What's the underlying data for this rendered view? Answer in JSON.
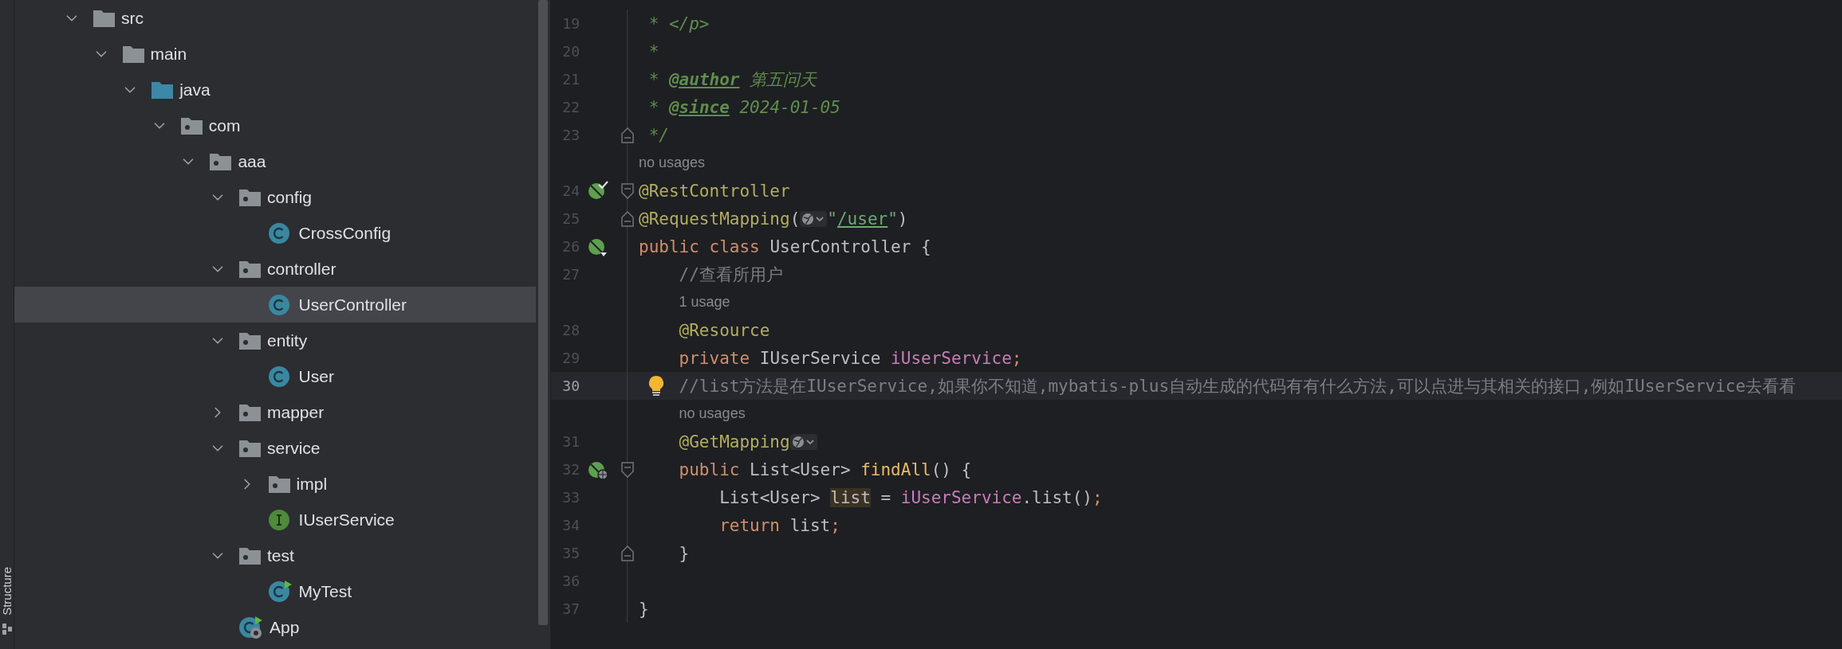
{
  "tool_strip": {
    "label": "Structure"
  },
  "project_tree": [
    {
      "label": "src",
      "kind": "folder",
      "expanded": true,
      "selected": false,
      "children": [
        {
          "label": "main",
          "kind": "folder",
          "expanded": true,
          "selected": false,
          "children": [
            {
              "label": "java",
              "kind": "source-folder",
              "expanded": true,
              "selected": false,
              "children": [
                {
                  "label": "com",
                  "kind": "package",
                  "expanded": true,
                  "selected": false,
                  "children": [
                    {
                      "label": "aaa",
                      "kind": "package",
                      "expanded": true,
                      "selected": false,
                      "children": [
                        {
                          "label": "config",
                          "kind": "package",
                          "expanded": true,
                          "selected": false,
                          "children": [
                            {
                              "label": "CrossConfig",
                              "kind": "class",
                              "selected": false
                            }
                          ]
                        },
                        {
                          "label": "controller",
                          "kind": "package",
                          "expanded": true,
                          "selected": false,
                          "children": [
                            {
                              "label": "UserController",
                              "kind": "class",
                              "selected": true
                            }
                          ]
                        },
                        {
                          "label": "entity",
                          "kind": "package",
                          "expanded": true,
                          "selected": false,
                          "children": [
                            {
                              "label": "User",
                              "kind": "class",
                              "selected": false
                            }
                          ]
                        },
                        {
                          "label": "mapper",
                          "kind": "package",
                          "expanded": false,
                          "selected": false
                        },
                        {
                          "label": "service",
                          "kind": "package",
                          "expanded": true,
                          "selected": false,
                          "children": [
                            {
                              "label": "impl",
                              "kind": "package",
                              "expanded": false,
                              "selected": false
                            },
                            {
                              "label": "IUserService",
                              "kind": "interface",
                              "selected": false
                            }
                          ]
                        },
                        {
                          "label": "test",
                          "kind": "package",
                          "expanded": true,
                          "selected": false,
                          "children": [
                            {
                              "label": "MyTest",
                              "kind": "test-class",
                              "selected": false
                            }
                          ]
                        },
                        {
                          "label": "App",
                          "kind": "app-class",
                          "selected": false
                        }
                      ]
                    }
                  ]
                }
              ]
            }
          ]
        }
      ]
    }
  ],
  "editor_lines": [
    {
      "kind": "code",
      "number": "19",
      "current": false,
      "tokens": [
        {
          "kind": "doc",
          "text": " * </p>"
        }
      ]
    },
    {
      "kind": "code",
      "number": "20",
      "current": false,
      "tokens": [
        {
          "kind": "doc",
          "text": " *"
        }
      ]
    },
    {
      "kind": "code",
      "number": "21",
      "current": false,
      "tokens": [
        {
          "kind": "doc",
          "text": " * "
        },
        {
          "kind": "doctag",
          "text": "@author"
        },
        {
          "kind": "doc",
          "text": " 第五问天"
        }
      ]
    },
    {
      "kind": "code",
      "number": "22",
      "current": false,
      "tokens": [
        {
          "kind": "doc",
          "text": " * "
        },
        {
          "kind": "doctag",
          "text": "@since"
        },
        {
          "kind": "doc",
          "text": " 2024-01-05"
        }
      ]
    },
    {
      "kind": "code",
      "number": "23",
      "current": false,
      "fold": {
        "kind": "end"
      },
      "tokens": [
        {
          "kind": "doc",
          "text": " */"
        }
      ]
    },
    {
      "kind": "inlay",
      "text": "no usages"
    },
    {
      "kind": "code",
      "number": "24",
      "current": false,
      "fold": {
        "kind": "start"
      },
      "gutter_icon": {
        "kind": "bean-check"
      },
      "tokens": [
        {
          "kind": "annotation",
          "text": "@RestController"
        }
      ]
    },
    {
      "kind": "code",
      "number": "25",
      "current": false,
      "fold": {
        "kind": "end"
      },
      "tokens": [
        {
          "kind": "annotation",
          "text": "@RequestMapping"
        },
        {
          "kind": "plain",
          "text": "("
        },
        {
          "kind": "globe"
        },
        {
          "kind": "string",
          "text": "\""
        },
        {
          "kind": "link",
          "text": "/user"
        },
        {
          "kind": "string",
          "text": "\""
        },
        {
          "kind": "plain",
          "text": ")"
        }
      ]
    },
    {
      "kind": "code",
      "number": "26",
      "current": false,
      "gutter_icon": {
        "kind": "bean-down"
      },
      "tokens": [
        {
          "kind": "keyword",
          "text": "public class "
        },
        {
          "kind": "plain",
          "text": "UserController {"
        }
      ]
    },
    {
      "kind": "code",
      "number": "27",
      "current": false,
      "tokens": [
        {
          "kind": "comment",
          "text": "    //查看所用户"
        }
      ]
    },
    {
      "kind": "inlay",
      "text": "1 usage"
    },
    {
      "kind": "code",
      "number": "28",
      "current": false,
      "tokens": [
        {
          "kind": "annotation",
          "text": "    @Resource"
        }
      ]
    },
    {
      "kind": "code",
      "number": "29",
      "current": false,
      "tokens": [
        {
          "kind": "keyword",
          "text": "    private "
        },
        {
          "kind": "plain",
          "text": "IUserService "
        },
        {
          "kind": "field",
          "text": "iUserService"
        },
        {
          "kind": "keyword",
          "text": ";"
        }
      ]
    },
    {
      "kind": "code",
      "number": "30",
      "current": true,
      "bulb": true,
      "tokens": [
        {
          "kind": "comment",
          "text": "    //list方法是在IUserService,如果你不知道,mybatis-plus自动生成的代码有有什么方法,可以点进与其相关的接口,例如IUserService去看看"
        }
      ]
    },
    {
      "kind": "inlay",
      "text": "no usages"
    },
    {
      "kind": "code",
      "number": "31",
      "current": false,
      "tokens": [
        {
          "kind": "annotation",
          "text": "    @GetMapping"
        },
        {
          "kind": "globe"
        }
      ]
    },
    {
      "kind": "code",
      "number": "32",
      "current": false,
      "fold": {
        "kind": "start"
      },
      "gutter_icon": {
        "kind": "bean-web"
      },
      "tokens": [
        {
          "kind": "keyword",
          "text": "    public "
        },
        {
          "kind": "plain",
          "text": "List<User> "
        },
        {
          "kind": "method",
          "text": "findAll"
        },
        {
          "kind": "plain",
          "text": "() {"
        }
      ]
    },
    {
      "kind": "code",
      "number": "33",
      "current": false,
      "tokens": [
        {
          "kind": "plain",
          "text": "        List<User> "
        },
        {
          "kind": "usage",
          "text": "list"
        },
        {
          "kind": "plain",
          "text": " = "
        },
        {
          "kind": "field",
          "text": "iUserService"
        },
        {
          "kind": "plain",
          "text": ".list()"
        },
        {
          "kind": "keyword",
          "text": ";"
        }
      ]
    },
    {
      "kind": "code",
      "number": "34",
      "current": false,
      "tokens": [
        {
          "kind": "keyword",
          "text": "        return "
        },
        {
          "kind": "plain",
          "text": "list"
        },
        {
          "kind": "keyword",
          "text": ";"
        }
      ]
    },
    {
      "kind": "code",
      "number": "35",
      "current": false,
      "fold": {
        "kind": "end"
      },
      "tokens": [
        {
          "kind": "plain",
          "text": "    }"
        }
      ]
    },
    {
      "kind": "code",
      "number": "36",
      "current": false
    },
    {
      "kind": "code",
      "number": "37",
      "current": false,
      "tokens": [
        {
          "kind": "plain",
          "text": "}"
        }
      ]
    }
  ]
}
